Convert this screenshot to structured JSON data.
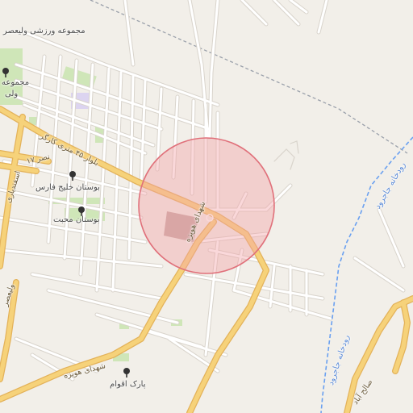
{
  "colors": {
    "background": "#f2efe9",
    "major_road": "#f6d27a",
    "major_road_casing": "#e3b25a",
    "minor_road": "#ffffff",
    "minor_road_casing": "#d9d4cc",
    "park": "#cfe6b8",
    "water": "#6aa0f0",
    "boundary": "#9aa0aa",
    "highlight_fill": "#f4a3a8",
    "highlight_stroke": "#e0707a"
  },
  "map": {
    "highlight_circle": {
      "shown": true
    },
    "labels": {
      "sports_complex_top": "مجموعه ورزشی ولیعصر",
      "sports_complex_left_line1": "مجموعه",
      "sports_complex_left_line2": "ولی",
      "road_45m": "بلوار ۴۵ متری کارگر",
      "road_nasr": "نصر ۱۷",
      "road_esfandiari": "اسفندیاری",
      "park_khalij_fars": "بوستان خلیج فارس",
      "park_mohebbat": "بوستان محبت",
      "road_valiasr": "ولیعصر",
      "road_shohada_howeyzeh_1": "شهدای هویزه",
      "road_shohada_howeyzeh_2": "شهدای هویزه",
      "park_aqvam": "پارک اقوام",
      "river_jajrud_1": "رودخانه جاجرود",
      "river_jajrud_2": "رودخانه جاجرود",
      "road_saleh_abad": "صالح آباد"
    },
    "poi_icons": [
      "tree-icon",
      "tree-icon",
      "tree-icon",
      "tree-icon"
    ]
  }
}
